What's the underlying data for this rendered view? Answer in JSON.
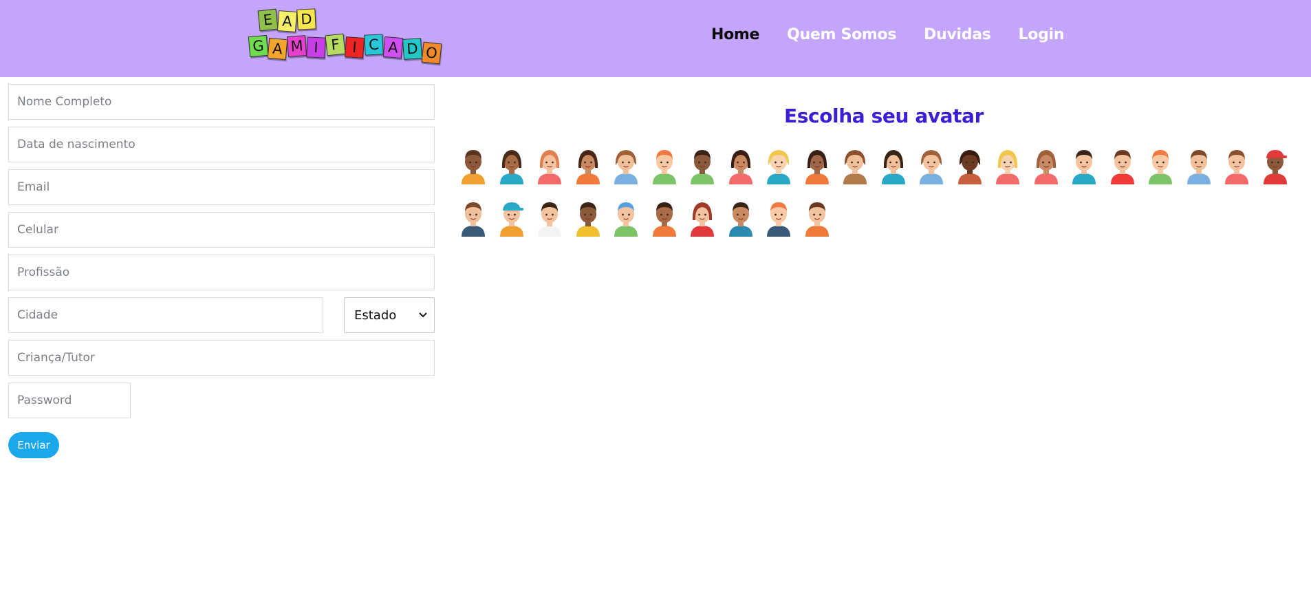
{
  "header": {
    "logo_lines": [
      "EAD",
      "GAMIFICADO"
    ],
    "nav": [
      {
        "label": "Home",
        "active": true
      },
      {
        "label": "Quem Somos",
        "active": false
      },
      {
        "label": "Duvidas",
        "active": false
      },
      {
        "label": "Login",
        "active": false
      }
    ]
  },
  "form": {
    "nome": {
      "placeholder": "Nome Completo",
      "value": ""
    },
    "nascimento": {
      "placeholder": "Data de nascimento",
      "value": ""
    },
    "email": {
      "placeholder": "Email",
      "value": ""
    },
    "celular": {
      "placeholder": "Celular",
      "value": ""
    },
    "profissao": {
      "placeholder": "Profissão",
      "value": ""
    },
    "cidade": {
      "placeholder": "Cidade",
      "value": ""
    },
    "estado": {
      "selected": "Estado"
    },
    "crianca": {
      "placeholder": "Criança/Tutor",
      "value": ""
    },
    "password": {
      "placeholder": "Password",
      "value": ""
    },
    "submit_label": "Enviar"
  },
  "avatars": {
    "title": "Escolha seu avatar",
    "count": 32
  },
  "colors": {
    "navbar": "#c3a5fb",
    "title": "#3b1fd6",
    "button": "#1aa7ec"
  }
}
